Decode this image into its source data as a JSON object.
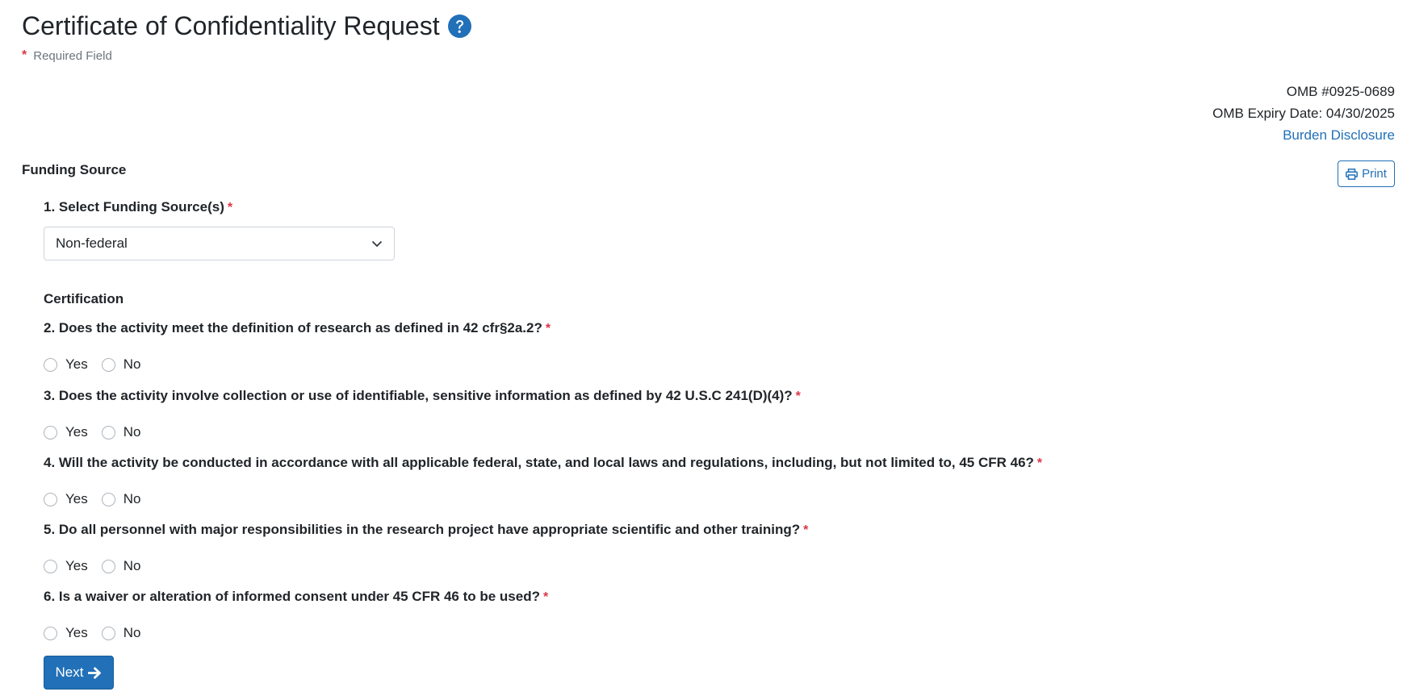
{
  "header": {
    "title": "Certificate of Confidentiality Request",
    "required_note": "Required Field",
    "required_marker": "*"
  },
  "omb": {
    "number": "OMB #0925-0689",
    "expiry": "OMB Expiry Date: 04/30/2025",
    "burden_link": "Burden Disclosure"
  },
  "toolbar": {
    "print_label": "Print"
  },
  "funding": {
    "heading": "Funding Source",
    "question": "1. Select Funding Source(s)",
    "selected_value": "Non-federal"
  },
  "certification": {
    "heading": "Certification",
    "yes_label": "Yes",
    "no_label": "No",
    "questions": [
      "2. Does the activity meet the definition of research as defined in 42 cfr§2a.2?",
      "3. Does the activity involve collection or use of identifiable, sensitive information as defined by 42 U.S.C 241(D)(4)?",
      "4. Will the activity be conducted in accordance with all applicable federal, state, and local laws and regulations, including, but not limited to, 45 CFR 46?",
      "5. Do all personnel with major responsibilities in the research project have appropriate scientific and other training?",
      "6. Is a waiver or alteration of informed consent under 45 CFR 46 to be used?"
    ]
  },
  "actions": {
    "next_label": "Next"
  },
  "colors": {
    "primary": "#2170b8",
    "required": "#dc3545",
    "muted": "#6c757d"
  }
}
